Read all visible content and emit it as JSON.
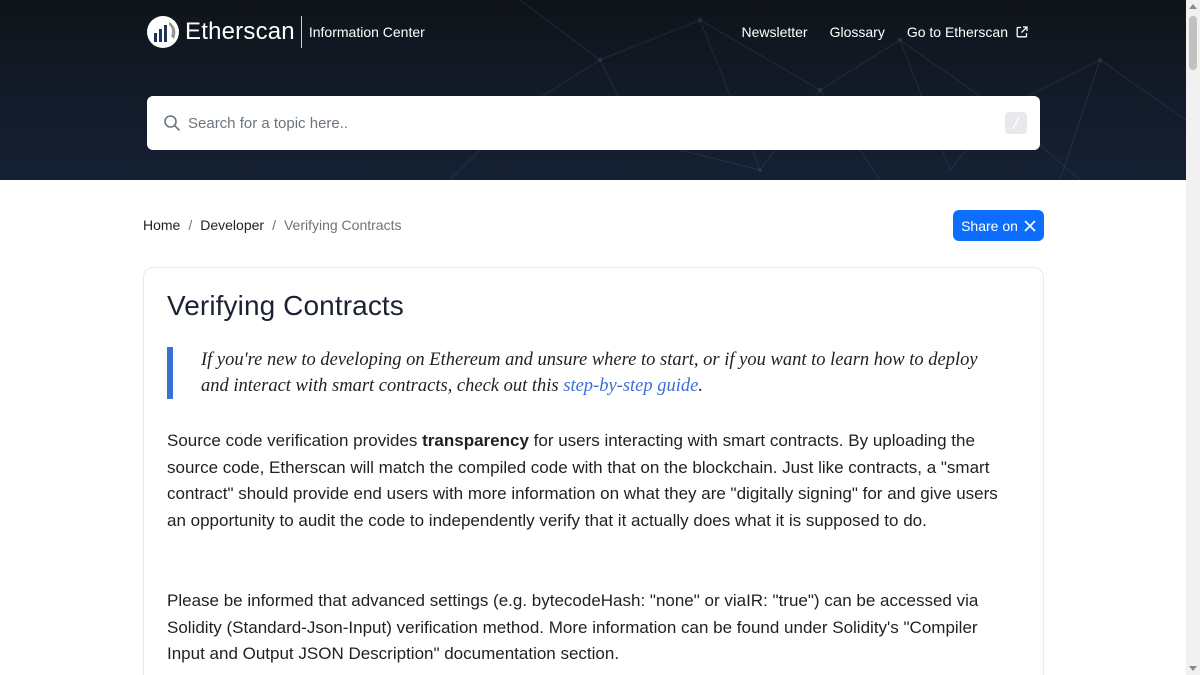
{
  "header": {
    "brand": "Etherscan",
    "subtitle": "Information Center",
    "nav": {
      "newsletter": "Newsletter",
      "glossary": "Glossary",
      "go_to": "Go to Etherscan"
    },
    "search": {
      "placeholder": "Search for a topic here..",
      "shortcut": "/"
    }
  },
  "breadcrumb": {
    "home": "Home",
    "sep": "/",
    "developer": "Developer",
    "current": "Verifying Contracts"
  },
  "share": {
    "label": "Share on"
  },
  "article": {
    "title": "Verifying Contracts",
    "quote_text": "If you're new to developing on Ethereum and unsure where to start, or if you want to learn how to deploy and interact with smart contracts, check out this ",
    "quote_link": "step-by-step guide",
    "quote_end": ".",
    "p1_a": "Source code verification provides ",
    "p1_bold": "transparency",
    "p1_b": " for users interacting with smart contracts. By uploading the source code, Etherscan will match the compiled code with that on the blockchain. Just like contracts, a \"smart contract\" should provide end users with more information on what they are \"digitally signing\" for and give users an opportunity to audit the code to independently verify that it actually does what it is supposed to do.",
    "p2": "Please be informed that advanced settings (e.g. bytecodeHash: \"none\" or viaIR: \"true\") can be accessed via Solidity (Standard-Json-Input) verification method. More information can be found under Solidity's \"Compiler Input and Output JSON Description\" documentation section."
  },
  "colors": {
    "header_bg": "#121a27",
    "accent": "#0d6efd",
    "quote_border": "#3a6fd8"
  },
  "icons": {
    "search": "search-icon",
    "external": "external-link-icon",
    "x": "x-logo-icon",
    "logo": "etherscan-logo-icon"
  }
}
